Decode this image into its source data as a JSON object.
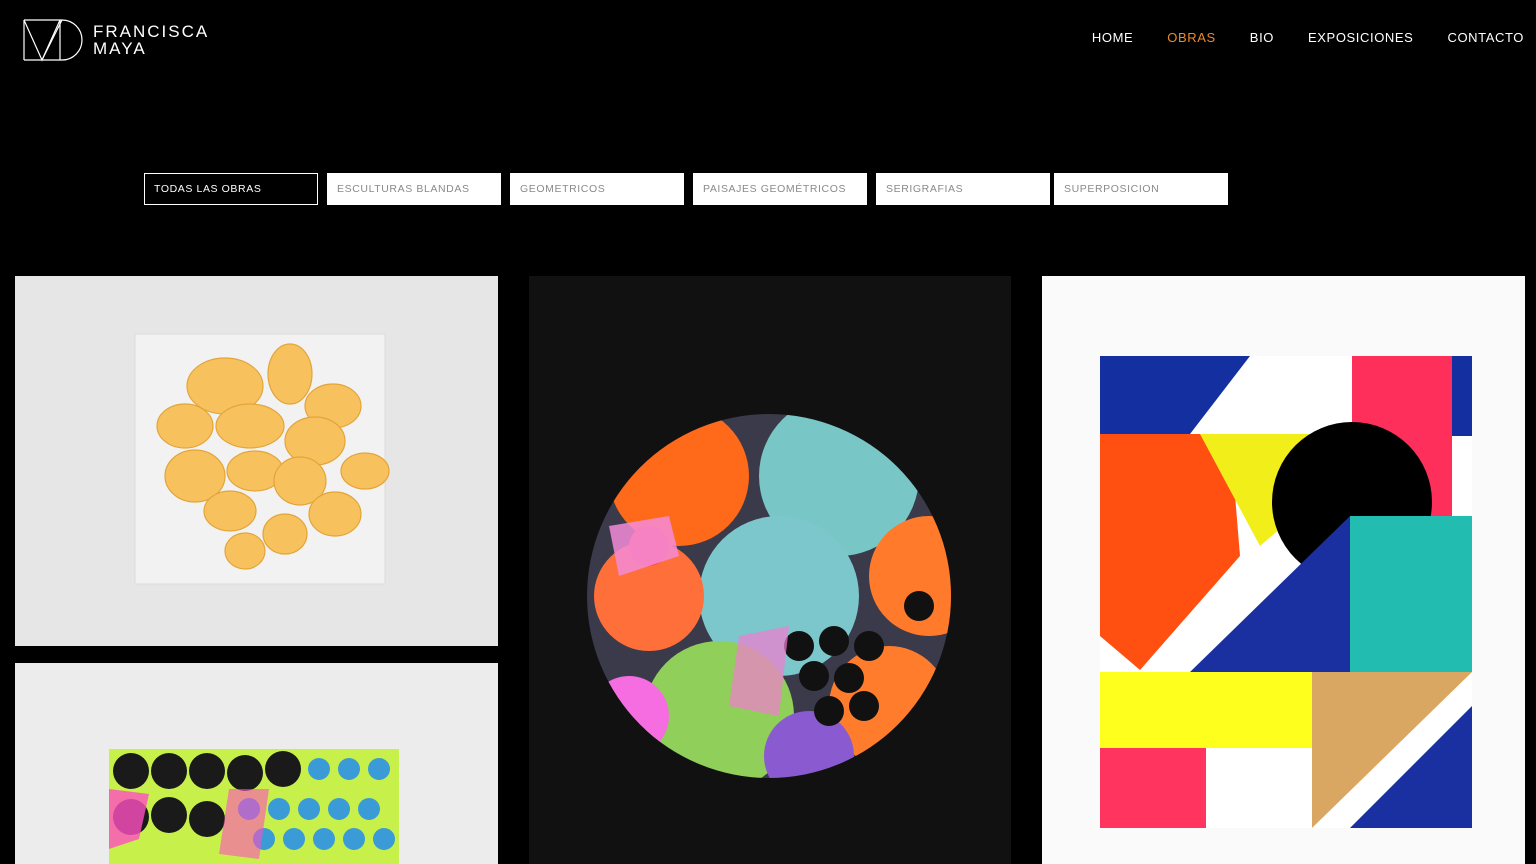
{
  "brand": {
    "line1": "FRANCISCA",
    "line2": "MAYA"
  },
  "nav": {
    "items": [
      {
        "label": "HOME"
      },
      {
        "label": "OBRAS",
        "active": true
      },
      {
        "label": "BIO"
      },
      {
        "label": "EXPOSICIONES"
      },
      {
        "label": "CONTACTO"
      }
    ],
    "active_color": "#e98b2a"
  },
  "filters": [
    {
      "label": "TODAS LAS OBRAS",
      "active": true
    },
    {
      "label": "ESCULTURAS BLANDAS"
    },
    {
      "label": "GEOMETRICOS"
    },
    {
      "label": "PAISAJES GEOMÉTRICOS"
    },
    {
      "label": "SERIGRAFIAS"
    },
    {
      "label": "SUPERPOSICION"
    }
  ],
  "gallery": {
    "artworks": [
      {
        "subject": "soft-sculpture-yellow"
      },
      {
        "subject": "circle-painting"
      },
      {
        "subject": "geometric-painting"
      },
      {
        "subject": "dots-painting"
      }
    ]
  }
}
